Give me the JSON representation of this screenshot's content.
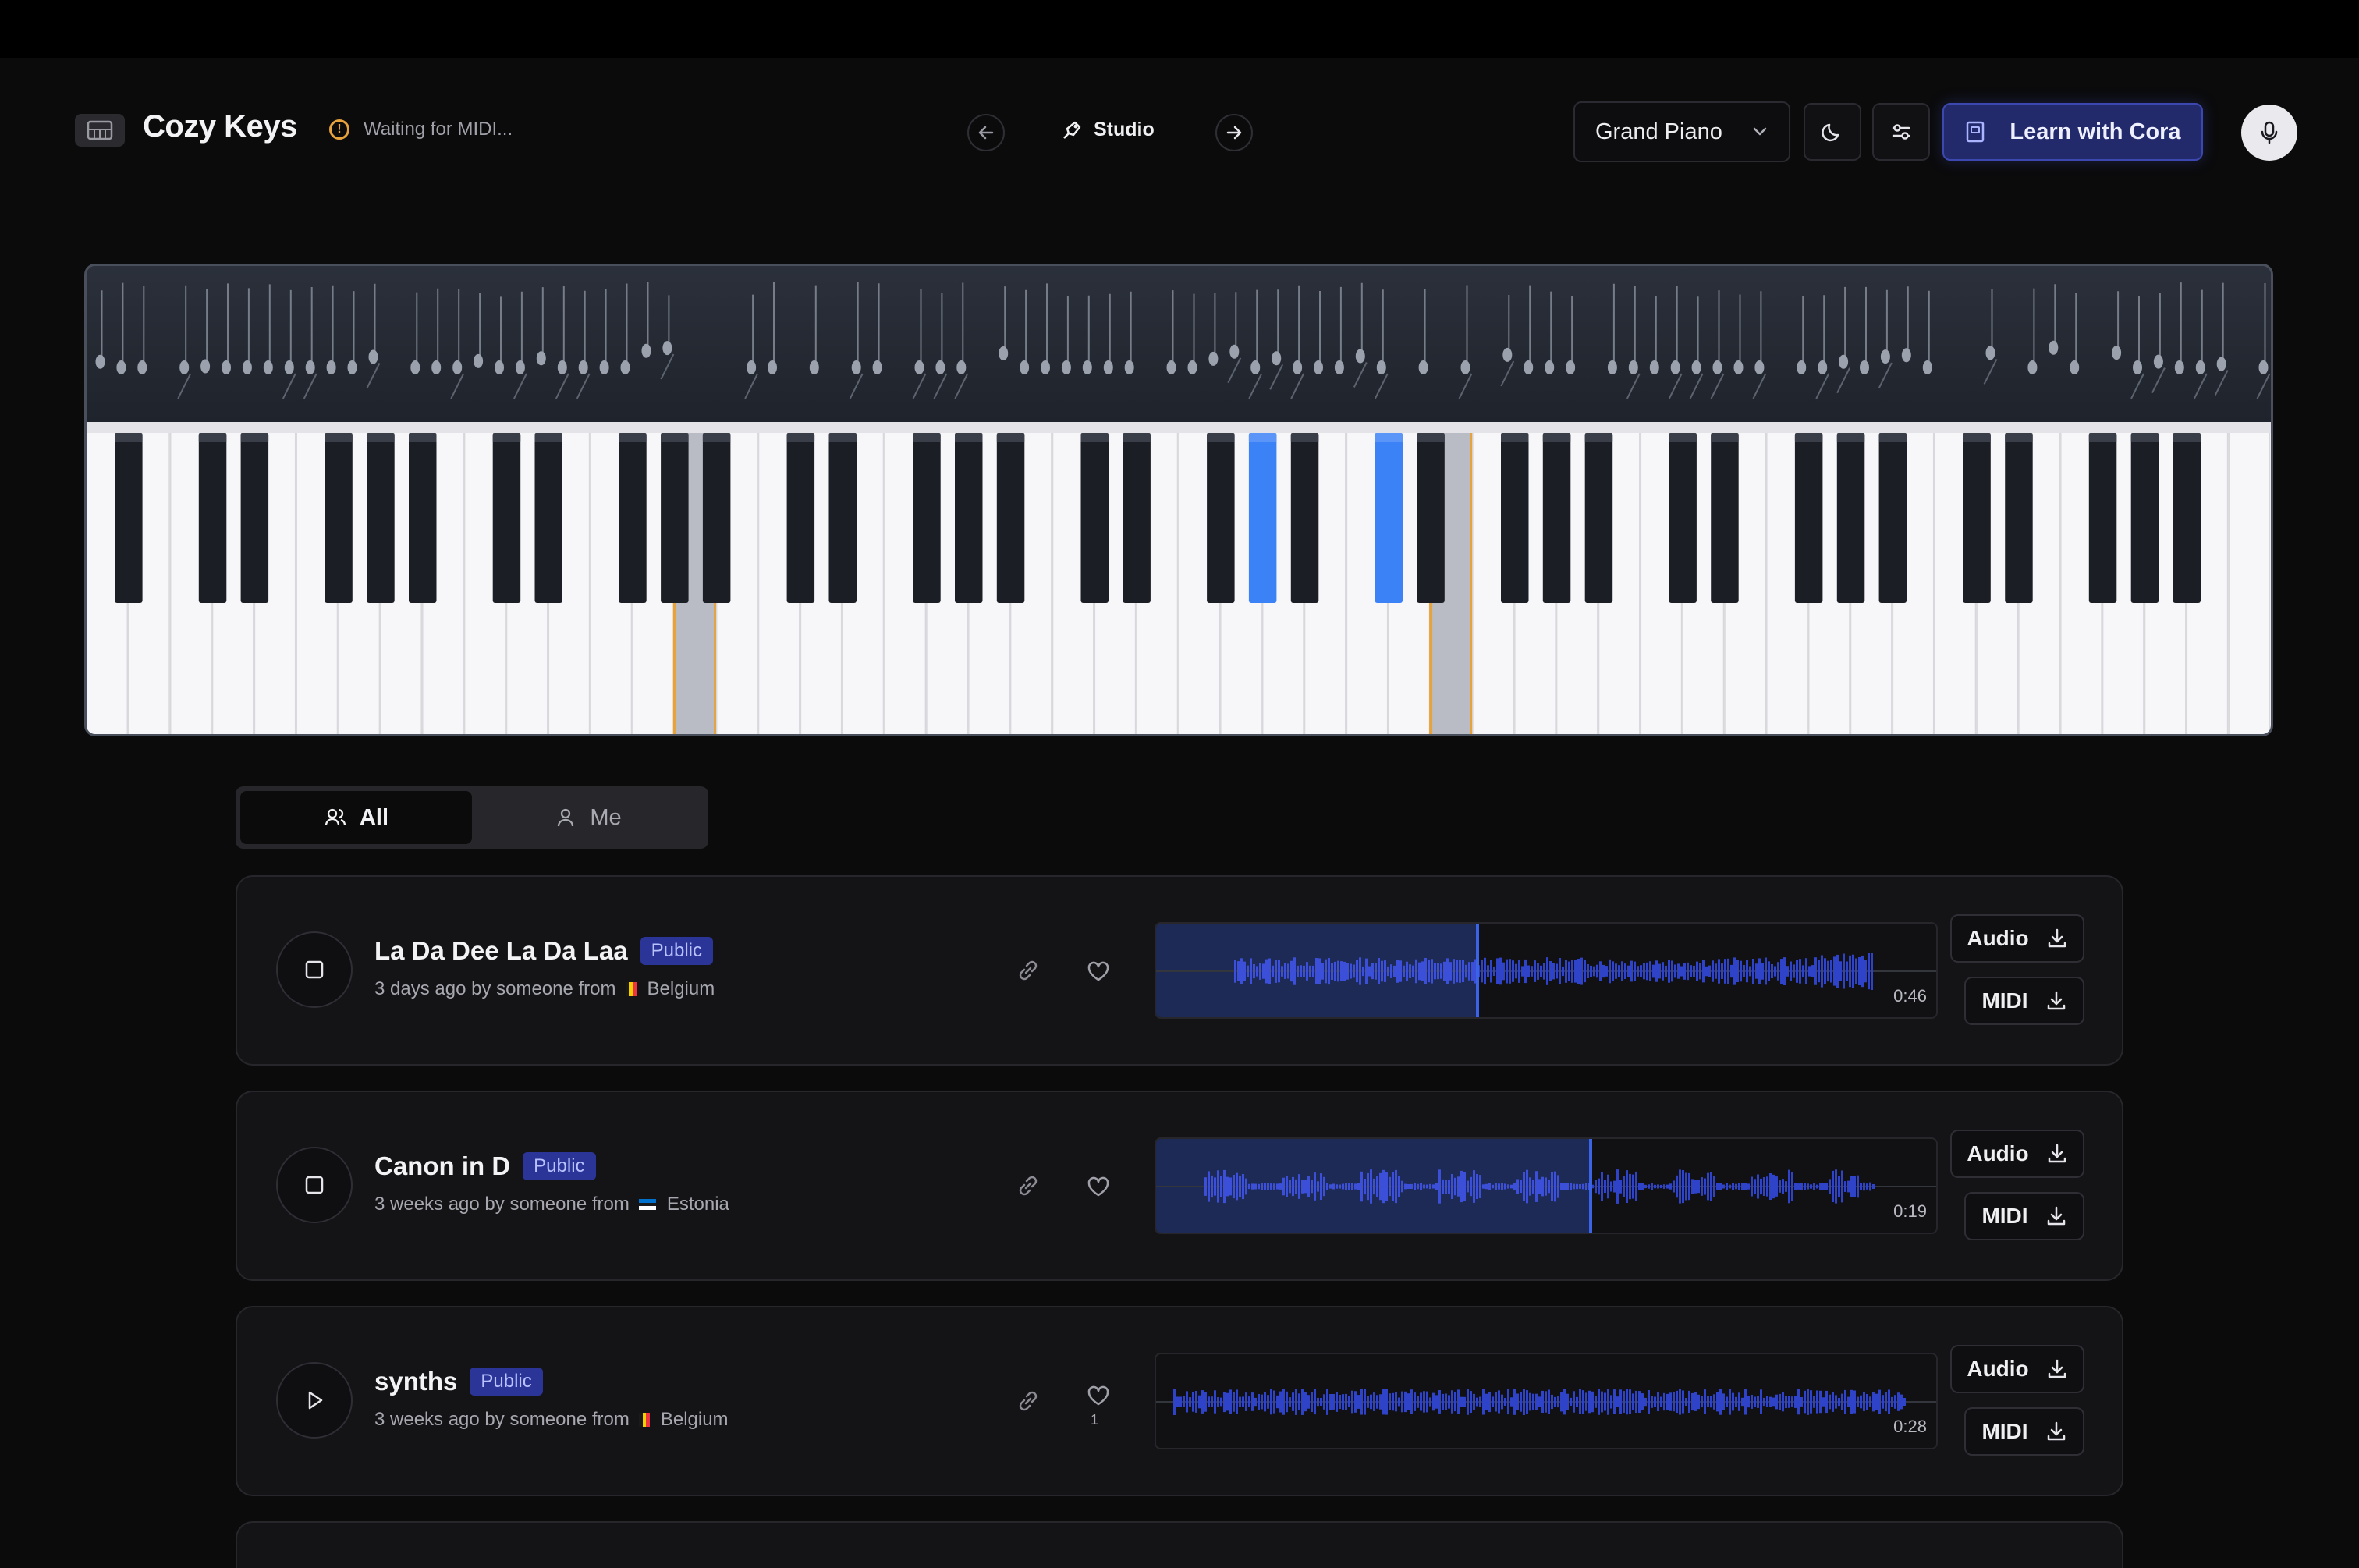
{
  "header": {
    "brand": "Cozy Keys",
    "midi_status": "Waiting for MIDI...",
    "mode_label": "Studio",
    "instrument": "Grand Piano",
    "learn_label": "Learn with Cora"
  },
  "piano": {
    "highlighted_white_keys": [
      14,
      32
    ],
    "highlighted_black_keys": [
      19,
      21
    ]
  },
  "filter": {
    "tabs": [
      {
        "label": "All",
        "active": true
      },
      {
        "label": "Me",
        "active": false
      }
    ]
  },
  "recordings": [
    {
      "title": "La Da Dee La Da Laa",
      "badge": "Public",
      "meta_prefix": "3 days ago by someone from",
      "country": "Belgium",
      "duration": "0:46",
      "progress": 0.41,
      "likes": "",
      "state": "stop",
      "audio_label": "Audio",
      "midi_label": "MIDI"
    },
    {
      "title": "Canon in D",
      "badge": "Public",
      "meta_prefix": "3 weeks ago by someone from",
      "country": "Estonia",
      "duration": "0:19",
      "progress": 0.555,
      "likes": "",
      "state": "stop",
      "audio_label": "Audio",
      "midi_label": "MIDI"
    },
    {
      "title": "synths",
      "badge": "Public",
      "meta_prefix": "3 weeks ago by someone from",
      "country": "Belgium",
      "duration": "0:28",
      "progress": 0,
      "likes": "1",
      "state": "play",
      "audio_label": "Audio",
      "midi_label": "MIDI"
    }
  ],
  "colors": {
    "accent": "#3a63e6",
    "pressed_key": "#3b82f6",
    "highlight_outline": "#e6a23c",
    "badge_bg": "#2b3598"
  }
}
